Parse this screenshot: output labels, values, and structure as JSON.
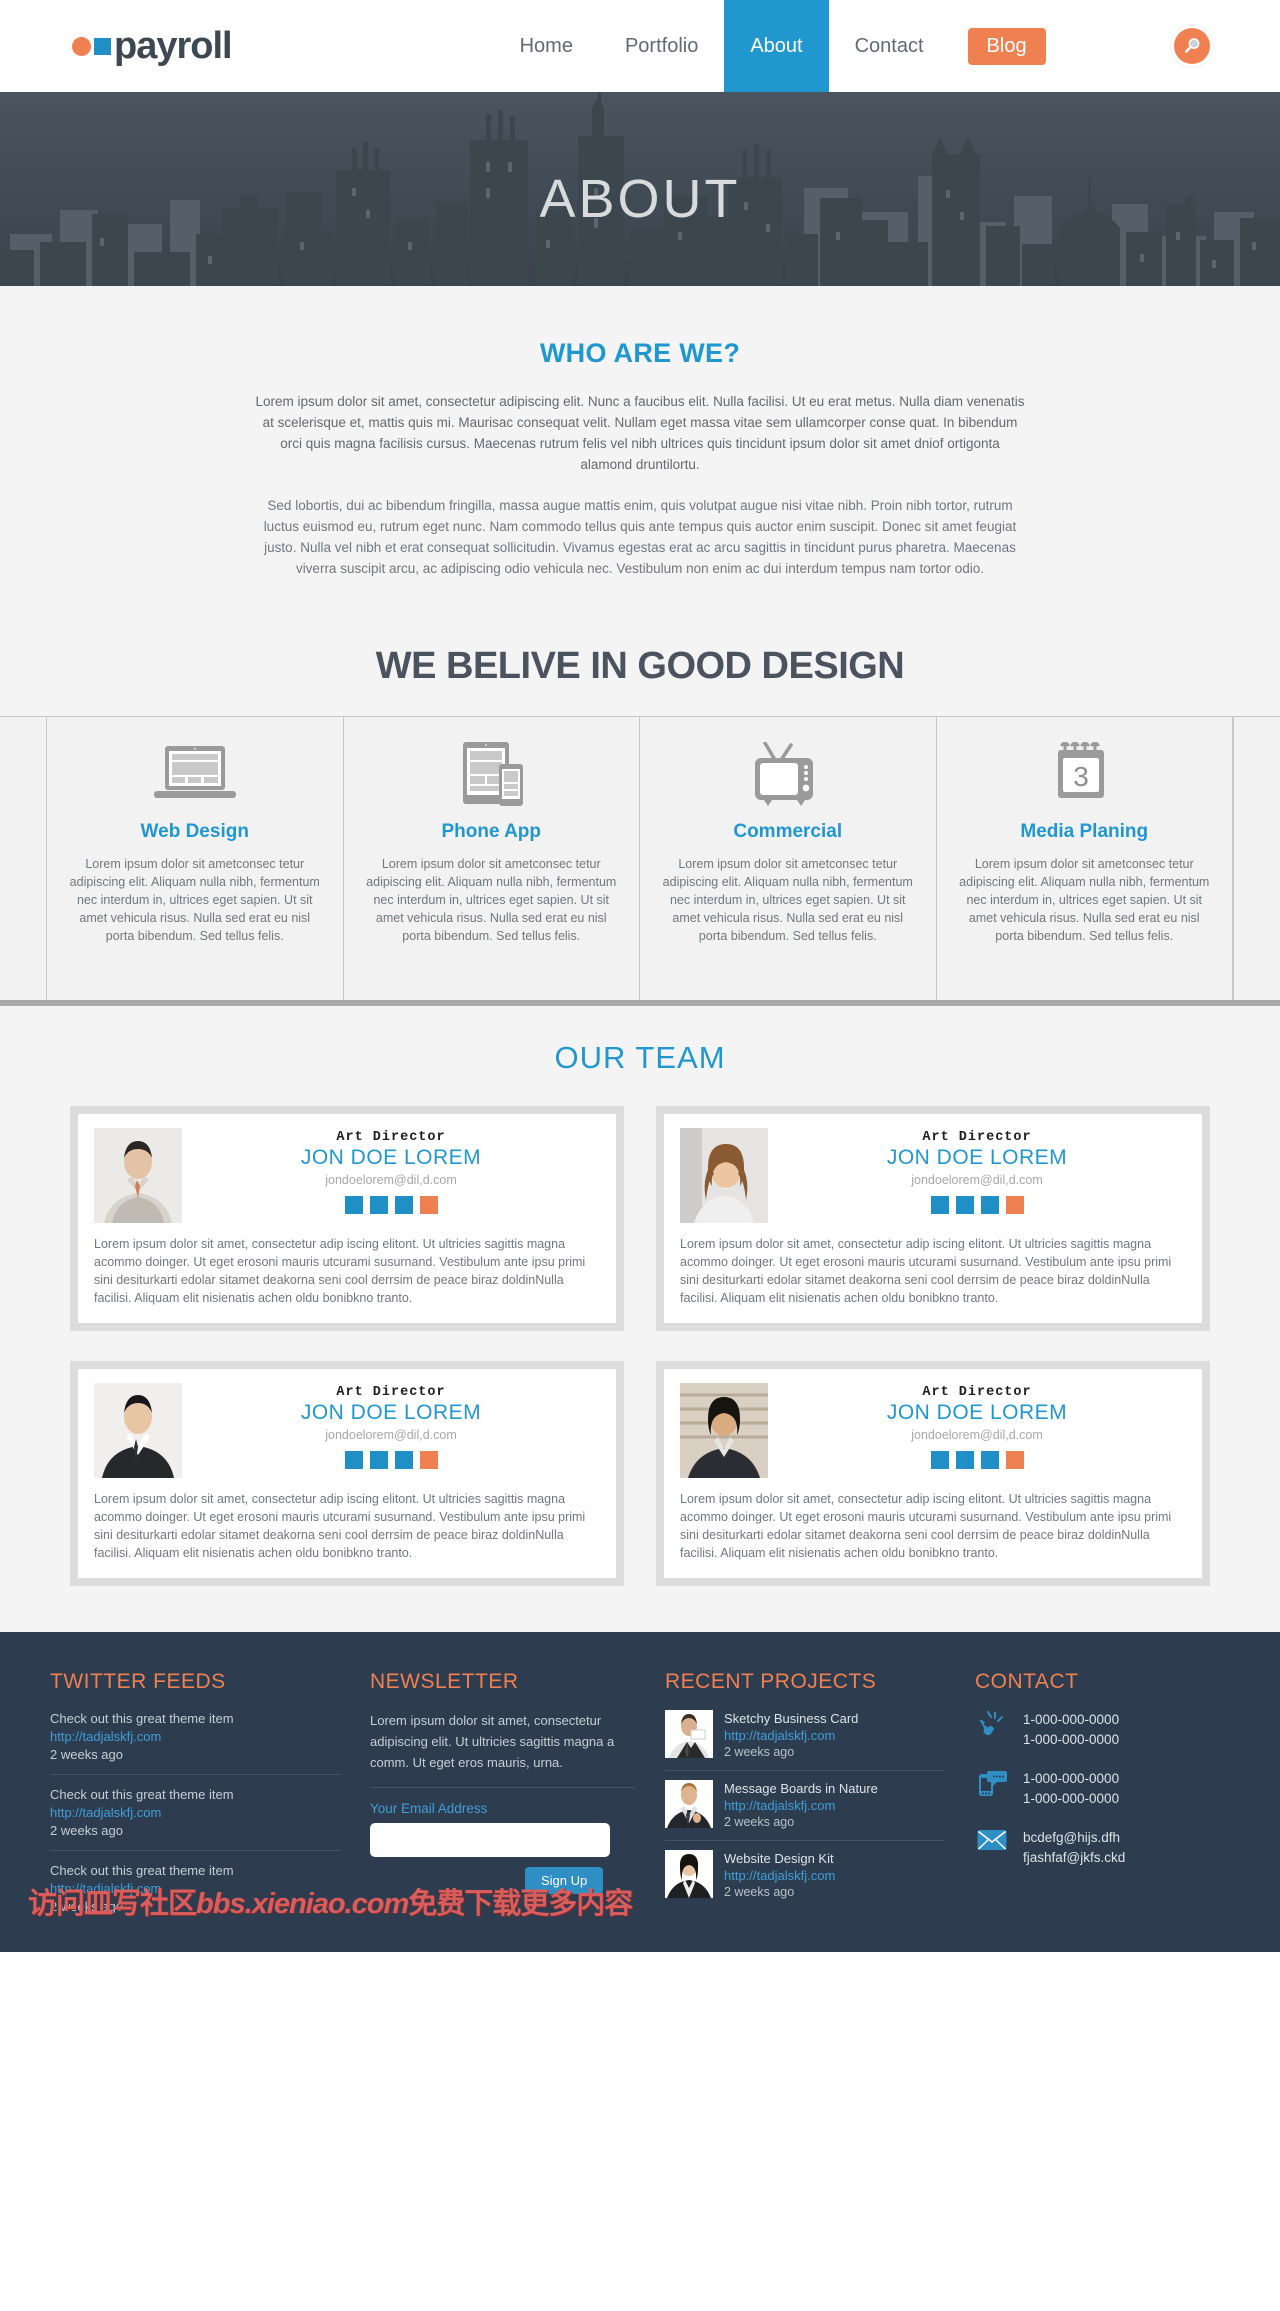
{
  "brand": {
    "name": "payroll",
    "dot_color": "#ef8052",
    "square_color": "#1f8fc6"
  },
  "nav": {
    "items": [
      {
        "label": "Home",
        "active": false
      },
      {
        "label": "Portfolio",
        "active": false
      },
      {
        "label": "About",
        "active": true
      },
      {
        "label": "Contact",
        "active": false
      }
    ],
    "blog_label": "Blog",
    "search_icon": "search-icon",
    "active_color": "#2197d0",
    "blog_color": "#ef8052"
  },
  "hero": {
    "title": "ABOUT"
  },
  "who": {
    "heading": "WHO ARE WE?",
    "paragraph1": "Lorem ipsum dolor sit amet, consectetur adipiscing elit. Nunc a faucibus elit. Nulla facilisi. Ut eu erat metus. Nulla diam venenatis at scelerisque et, mattis quis mi. Maurisac consequat velit. Nullam eget massa vitae sem ullamcorper conse quat. In bibendum orci quis magna facilisis cursus. Maecenas rutrum felis vel nibh ultrices quis tincidunt ipsum dolor sit amet dniof ortigonta alamond druntilortu.",
    "paragraph2": "Sed lobortis, dui ac bibendum fringilla, massa augue mattis enim, quis volutpat augue nisi vitae nibh. Proin nibh tortor, rutrum luctus euismod eu, rutrum eget nunc. Nam commodo tellus quis ante tempus quis auctor enim suscipit. Donec sit amet feugiat justo. Nulla vel nibh et erat consequat sollicitudin. Vivamus egestas erat ac arcu sagittis in tincidunt purus pharetra. Maecenas viverra suscipit arcu, ac adipiscing odio vehicula nec. Vestibulum non enim ac dui interdum tempus nam tortor odio."
  },
  "believe": {
    "heading": "WE BELIVE IN GOOD DESIGN",
    "services": [
      {
        "icon": "laptop-icon",
        "title": "Web Design",
        "text": "Lorem ipsum dolor sit ametconsec tetur adipiscing elit. Aliquam nulla nibh, fermentum nec interdum in, ultrices eget sapien. Ut sit amet vehicula risus. Nulla sed erat eu nisl porta bibendum. Sed tellus felis."
      },
      {
        "icon": "tablet-phone-icon",
        "title": "Phone App",
        "text": "Lorem ipsum dolor sit ametconsec tetur adipiscing elit. Aliquam nulla nibh, fermentum nec interdum in, ultrices eget sapien. Ut sit amet vehicula risus. Nulla sed erat eu nisl porta bibendum. Sed tellus felis."
      },
      {
        "icon": "television-icon",
        "title": "Commercial",
        "text": "Lorem ipsum dolor sit ametconsec tetur adipiscing elit. Aliquam nulla nibh, fermentum nec interdum in, ultrices eget sapien. Ut sit amet vehicula risus. Nulla sed erat eu nisl porta bibendum. Sed tellus felis."
      },
      {
        "icon": "calendar-icon",
        "calendar_day": "3",
        "title": "Media Planing",
        "text": "Lorem ipsum dolor sit ametconsec tetur adipiscing elit. Aliquam nulla nibh, fermentum nec interdum in, ultrices eget sapien. Ut sit amet vehicula risus. Nulla sed erat eu nisl porta bibendum. Sed tellus felis."
      }
    ]
  },
  "team": {
    "heading": "OUR TEAM",
    "bio": "Lorem ipsum dolor sit amet, consectetur adip iscing elitont. Ut ultricies sagittis magna acommo doinger. Ut eget erosoni mauris utcurami susurnand. Vestibulum ante ipsu primi sini desiturkarti edolar sitamet deakorna seni cool derrsim de peace biraz doldinNulla facilisi. Aliquam elit nisienatis achen oldu bonibkno tranto.",
    "members": [
      {
        "role": "Art Director",
        "name": "JON DOE LOREM",
        "email": "jondoelorem@dil,d.com",
        "photo": "asian-man-grey-suit-photo"
      },
      {
        "role": "Art Director",
        "name": "JON DOE LOREM",
        "email": "jondoelorem@dil,d.com",
        "photo": "smiling-woman-photo"
      },
      {
        "role": "Art Director",
        "name": "JON DOE LOREM",
        "email": "jondoelorem@dil,d.com",
        "photo": "man-black-suit-photo"
      },
      {
        "role": "Art Director",
        "name": "JON DOE LOREM",
        "email": "jondoelorem@dil,d.com",
        "photo": "businesswoman-photo"
      }
    ],
    "social_icons": [
      "facebook-square",
      "twitter-square",
      "linkedin-square",
      "rss-square"
    ]
  },
  "footer": {
    "twitter": {
      "title": "TWITTER FEEDS",
      "items": [
        {
          "text": "Check out this great theme item",
          "link": "http://tadjalskfj.com",
          "time": "2 weeks ago"
        },
        {
          "text": "Check out this great theme item",
          "link": "http://tadjalskfj.com",
          "time": "2 weeks ago"
        },
        {
          "text": "Check out this great theme item",
          "link": "http://tadjalskfj.com",
          "time": "2 weeks ago"
        }
      ]
    },
    "newsletter": {
      "title": "NEWSLETTER",
      "text": "Lorem ipsum dolor sit amet, consectetur adipiscing elit. Ut ultricies sagittis magna a comm. Ut eget eros mauris, urna.",
      "label": "Your Email Address",
      "input_value": "",
      "input_placeholder": "",
      "button_label": "Sign Up"
    },
    "projects": {
      "title": "RECENT PROJECTS",
      "items": [
        {
          "name": "Sketchy Business Card",
          "link": "http://tadjalskfj.com",
          "time": "2 weeks ago",
          "thumb": "man-holding-card-photo"
        },
        {
          "name": "Message Boards in Nature",
          "link": "http://tadjalskfj.com",
          "time": "2 weeks ago",
          "thumb": "man-thumbs-up-photo"
        },
        {
          "name": "Website Design Kit",
          "link": "http://tadjalskfj.com",
          "time": "2 weeks ago",
          "thumb": "woman-smiling-photo"
        }
      ]
    },
    "contact": {
      "title": "CONTACT",
      "rows": [
        {
          "icon": "phone-icon",
          "lines": [
            "1-000-000-0000",
            "1-000-000-0000"
          ]
        },
        {
          "icon": "mobile-sms-icon",
          "lines": [
            "1-000-000-0000",
            "1-000-000-0000"
          ]
        },
        {
          "icon": "envelope-icon",
          "lines": [
            "bcdefg@hijs.dfh",
            "fjashfaf@jkfs.ckd"
          ]
        }
      ]
    }
  },
  "watermark": {
    "cn1": "访问皿写社区",
    "latin": "bbs.xieniao.com",
    "cn2": "免费下载更多内容"
  }
}
